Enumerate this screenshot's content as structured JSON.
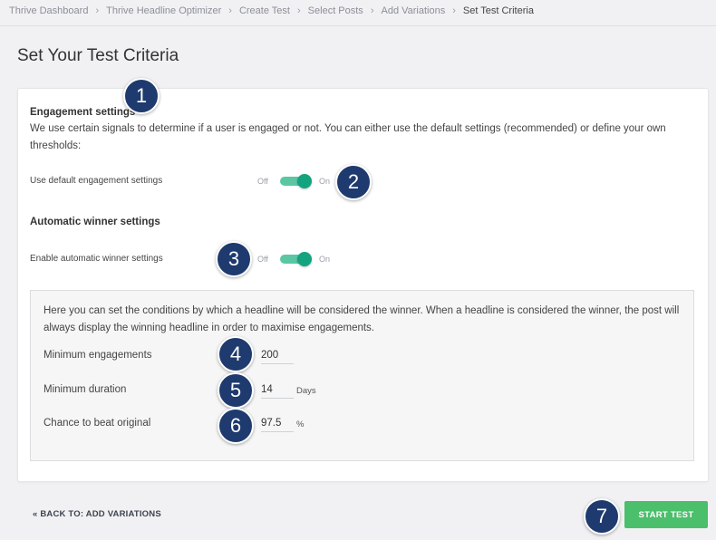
{
  "breadcrumb": {
    "items": [
      "Thrive Dashboard",
      "Thrive Headline Optimizer",
      "Create Test",
      "Select Posts",
      "Add Variations"
    ],
    "current": "Set Test Criteria",
    "separator": "›"
  },
  "page_title": "Set Your Test Criteria",
  "engagement": {
    "title": "Engagement settings",
    "description": "We use certain signals to determine if a user is engaged or not. You can either use the default settings (recommended) or define your own thresholds:",
    "toggle_label": "Use default engagement settings",
    "off_label": "Off",
    "on_label": "On",
    "enabled": true
  },
  "winner": {
    "title": "Automatic winner settings",
    "toggle_label": "Enable automatic winner settings",
    "off_label": "Off",
    "on_label": "On",
    "enabled": true,
    "description": "Here you can set the conditions by which a headline will be considered the winner. When a headline is considered the winner, the post will always display the winning headline in order to maximise engagements.",
    "fields": [
      {
        "label": "Minimum engagements",
        "value": "200",
        "unit": ""
      },
      {
        "label": "Minimum duration",
        "value": "14",
        "unit": "Days"
      },
      {
        "label": "Chance to beat original",
        "value": "97.5",
        "unit": "%"
      }
    ]
  },
  "footer": {
    "back_label": "« BACK TO: ADD VARIATIONS",
    "start_label": "START TEST"
  },
  "annotations": [
    "1",
    "2",
    "3",
    "4",
    "5",
    "6",
    "7"
  ],
  "colors": {
    "accent_green": "#14a37f",
    "toggle_track": "#5bc6a4",
    "start_button": "#4bbf6b",
    "badge": "#1e3a6e"
  }
}
